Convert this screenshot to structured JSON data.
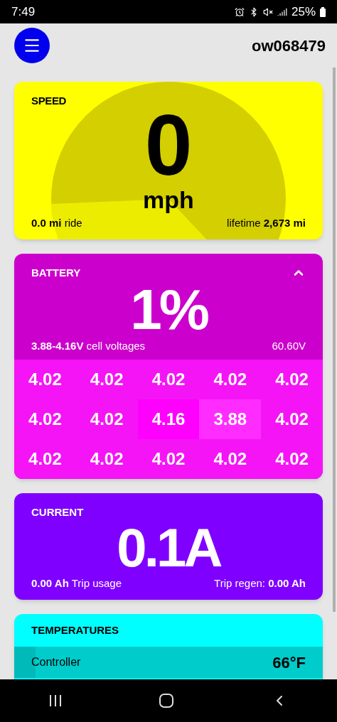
{
  "status_bar": {
    "time": "7:49",
    "battery": "25%"
  },
  "header": {
    "title": "ow068479"
  },
  "speed": {
    "title": "SPEED",
    "value": "0",
    "unit": "mph",
    "ride": "**0.0 mi** ride",
    "lifetime": "lifetime **2,673 mi**"
  },
  "battery": {
    "title": "BATTERY",
    "expanded": true,
    "percent": "1%",
    "range": "**3.88-4.16V** cell voltages",
    "voltage": "60.60V",
    "cells": [
      {
        "value": "4.02",
        "kind": "normal"
      },
      {
        "value": "4.02",
        "kind": "normal"
      },
      {
        "value": "4.02",
        "kind": "normal"
      },
      {
        "value": "4.02",
        "kind": "normal"
      },
      {
        "value": "4.02",
        "kind": "normal"
      },
      {
        "value": "4.02",
        "kind": "normal"
      },
      {
        "value": "4.02",
        "kind": "normal"
      },
      {
        "value": "4.16",
        "kind": "max"
      },
      {
        "value": "3.88",
        "kind": "min"
      },
      {
        "value": "4.02",
        "kind": "normal"
      },
      {
        "value": "4.02",
        "kind": "normal"
      },
      {
        "value": "4.02",
        "kind": "normal"
      },
      {
        "value": "4.02",
        "kind": "normal"
      },
      {
        "value": "4.02",
        "kind": "normal"
      },
      {
        "value": "4.02",
        "kind": "normal"
      }
    ]
  },
  "current": {
    "title": "CURRENT",
    "value": "0.1A",
    "trip_usage": "**0.00 Ah** Trip usage",
    "trip_regen": "Trip regen: **0.00 Ah**"
  },
  "temperatures": {
    "title": "TEMPERATURES",
    "rows": [
      {
        "name": "Controller",
        "value": "66°F",
        "level": 0.07
      }
    ]
  }
}
